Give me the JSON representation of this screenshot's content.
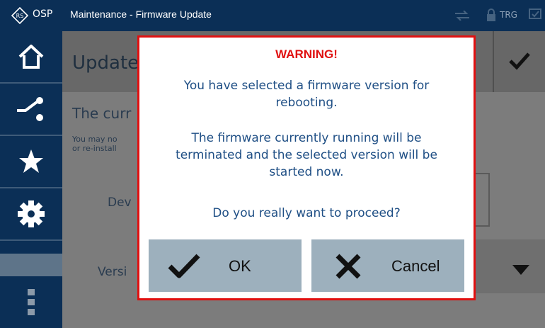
{
  "topbar": {
    "brand": "OSP",
    "title": "Maintenance - Firmware Update",
    "trg_label": "TRG",
    "icons": [
      "rs-logo-icon",
      "connection-icon",
      "lock-icon",
      "monitor-check-icon"
    ]
  },
  "sidebar": {
    "items": [
      {
        "name": "home-icon"
      },
      {
        "name": "switch-icon"
      },
      {
        "name": "star-icon"
      },
      {
        "name": "gear-icon"
      },
      {
        "name": "more-vertical-icon"
      }
    ]
  },
  "background": {
    "header_title": "Update",
    "line1": "The curr",
    "line2a": "You may no",
    "line2b": "or re-install",
    "device_label": "Dev",
    "version_label": "Versi"
  },
  "dialog": {
    "heading": "WARNING!",
    "msg1_line1": "You have selected a firmware version for",
    "msg1_line2": "rebooting.",
    "msg2_line1": "The firmware currently running will be",
    "msg2_line2": "terminated and the selected version will be",
    "msg2_line3": "started now.",
    "question": "Do you really want to proceed?",
    "ok_label": "OK",
    "cancel_label": "Cancel"
  },
  "colors": {
    "navy": "#0b2f56",
    "warning_red": "#e01010",
    "text_blue": "#1f4f85",
    "button_gray": "#9db0bd"
  }
}
